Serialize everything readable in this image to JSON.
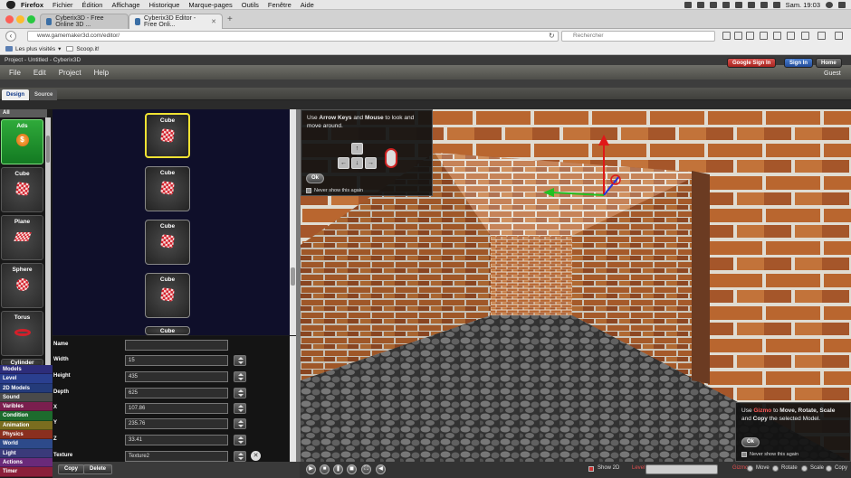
{
  "os_menubar": {
    "app": "Firefox",
    "items": [
      "Fichier",
      "Édition",
      "Affichage",
      "Historique",
      "Marque-pages",
      "Outils",
      "Fenêtre",
      "Aide"
    ],
    "clock": "Sam. 19:03"
  },
  "browser": {
    "tabs": [
      {
        "label": "Cyberix3D - Free Online 3D ..."
      },
      {
        "label": "Cyberix3D Editor - Free Onli..."
      }
    ],
    "url": "www.gamemaker3d.com/editor/",
    "search_placeholder": "Rechercher",
    "bookmarks": [
      "Les plus visités",
      "Scoop.it!"
    ]
  },
  "app": {
    "project_title": "Project - Untitled - Cyberix3D",
    "menu": [
      "File",
      "Edit",
      "Project",
      "Help"
    ],
    "buttons": {
      "google_sign_in": "Google Sign In",
      "sign_in": "Sign In",
      "home": "Home"
    },
    "user": "Guest",
    "mode_tabs": [
      "Design",
      "Source"
    ]
  },
  "categories": {
    "all_label": "All",
    "items": [
      "Ads",
      "Cube",
      "Plane",
      "Sphere",
      "Torus",
      "Cylinder"
    ]
  },
  "category_menu": [
    {
      "label": "Models",
      "color": "#2d2d7a"
    },
    {
      "label": "Level",
      "color": "#2a3f8f"
    },
    {
      "label": "2D Models",
      "color": "#243b7a"
    },
    {
      "label": "Sound",
      "color": "#4a4a4a"
    },
    {
      "label": "Varibles",
      "color": "#7a1f4e"
    },
    {
      "label": "Condition",
      "color": "#1d6b2d"
    },
    {
      "label": "Animation",
      "color": "#7a6d1f"
    },
    {
      "label": "Physics",
      "color": "#8a2f1f"
    },
    {
      "label": "World",
      "color": "#2d4a8a"
    },
    {
      "label": "Light",
      "color": "#3a3a7a"
    },
    {
      "label": "Actions",
      "color": "#6a2a7a"
    },
    {
      "label": "Timer",
      "color": "#8a1f3a"
    }
  ],
  "models": [
    "Cube",
    "Cube",
    "Cube",
    "Cube",
    "Cube"
  ],
  "properties": [
    {
      "label": "Name",
      "value": ""
    },
    {
      "label": "Width",
      "value": "15"
    },
    {
      "label": "Height",
      "value": "435"
    },
    {
      "label": "Depth",
      "value": "625"
    },
    {
      "label": "X",
      "value": "107.86"
    },
    {
      "label": "Y",
      "value": "235.76"
    },
    {
      "label": "Z",
      "value": "33.41"
    },
    {
      "label": "Texture",
      "value": "Texture2"
    }
  ],
  "bottom_left": {
    "copy": "Copy",
    "delete": "Delete"
  },
  "bottom_right": {
    "show2d": "Show 2D",
    "level": "Level",
    "gizmo": "Gizmo",
    "modes": [
      "Move",
      "Rotate",
      "Scale",
      "Copy"
    ]
  },
  "popup_keys": {
    "prefix": "Use",
    "keys_bold": "Arrow Keys",
    "and": "and",
    "mouse_bold": "Mouse",
    "suffix": "to look and move around.",
    "ok": "Ok",
    "never_show": "Never show this again"
  },
  "popup_gizmo": {
    "prefix": "Use",
    "gizmo_bold": "Gizmo",
    "mid1": "to",
    "move_bold": "Move, Rotate, Scale",
    "mid2": "and",
    "copy_bold": "Copy",
    "suffix": "the selected Model.",
    "ok": "Ok",
    "never_show": "Never show this again"
  },
  "colors": {
    "accent_green": "#2faa3a",
    "selection_yellow": "#f0e233",
    "brick": "#b05a2c",
    "gizmo_red": "#e01818",
    "gizmo_green": "#22c022",
    "gizmo_blue": "#2233dd"
  }
}
